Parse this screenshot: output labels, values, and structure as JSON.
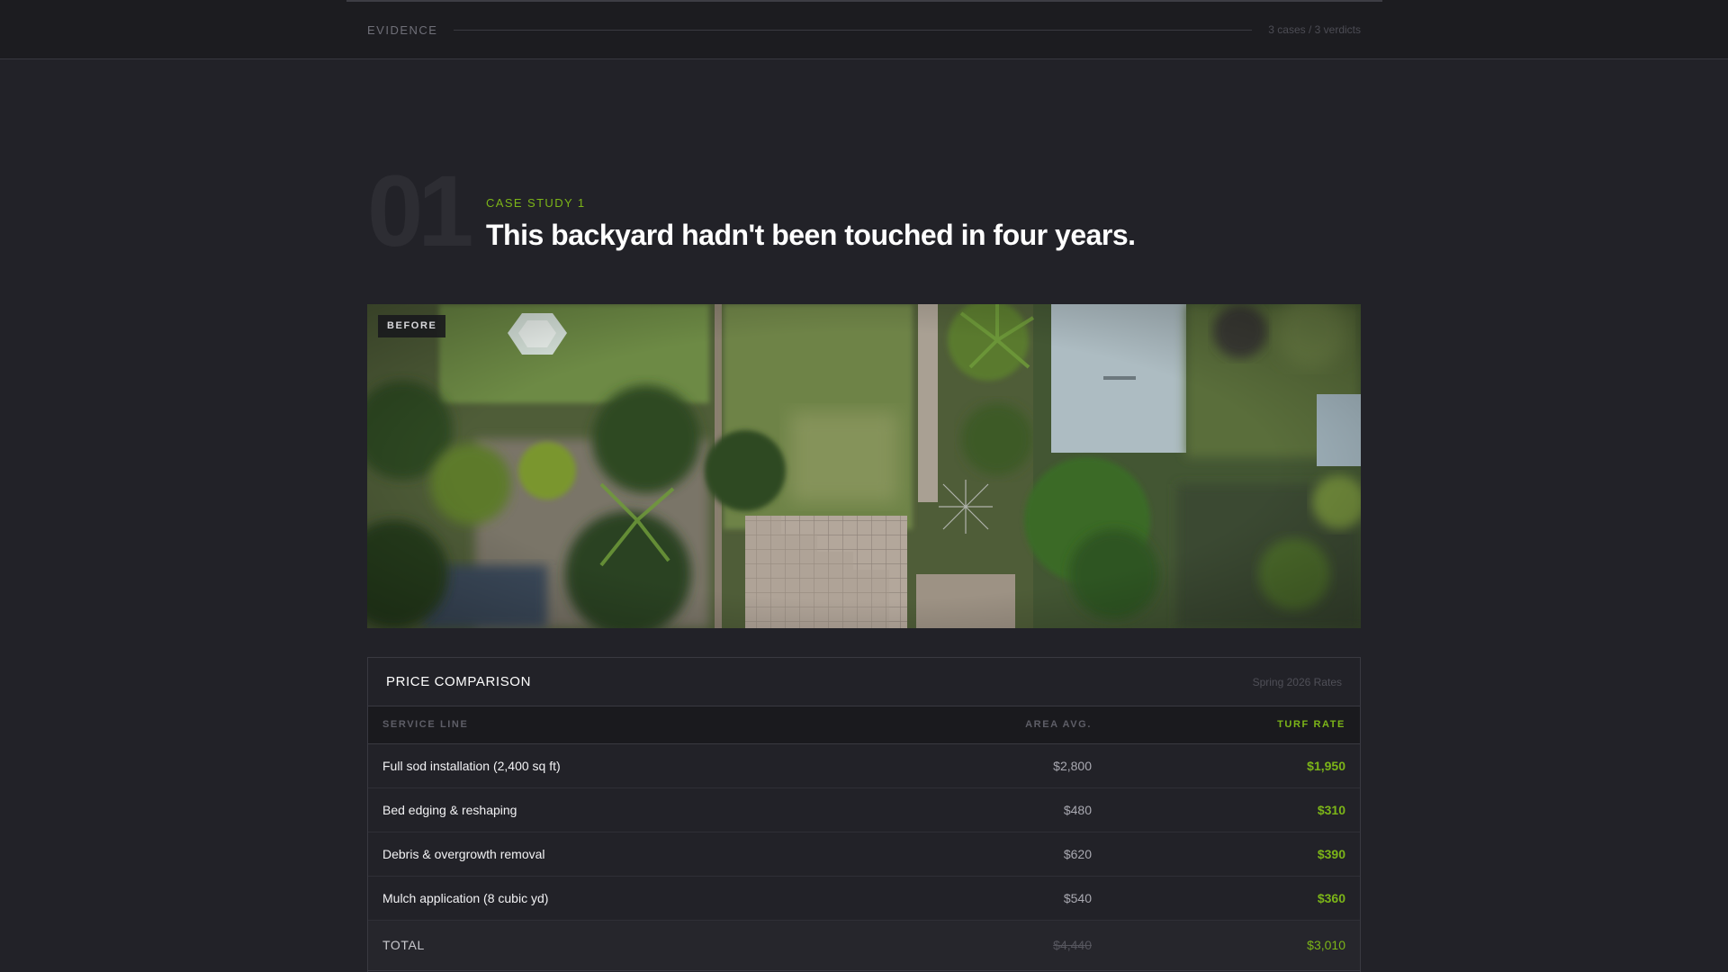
{
  "topbar": {
    "label": "EVIDENCE",
    "meta": "3 cases / 3 verdicts"
  },
  "case": {
    "number": "01",
    "kicker": "CASE STUDY 1",
    "title": "This backyard hadn't been touched in four years."
  },
  "photo": {
    "badge": "BEFORE"
  },
  "price": {
    "title": "PRICE COMPARISON",
    "subtitle": "Spring 2026 Rates",
    "headers": {
      "service": "SERVICE LINE",
      "area": "AREA AVG.",
      "turf": "TURF RATE"
    },
    "rows": [
      {
        "service": "Full sod installation (2,400 sq ft)",
        "area": "$2,800",
        "turf": "$1,950"
      },
      {
        "service": "Bed edging & reshaping",
        "area": "$480",
        "turf": "$310"
      },
      {
        "service": "Debris & overgrowth removal",
        "area": "$620",
        "turf": "$390"
      },
      {
        "service": "Mulch application (8 cubic yd)",
        "area": "$540",
        "turf": "$360"
      }
    ],
    "total": {
      "label": "TOTAL",
      "area": "$4,440",
      "turf": "$3,010"
    }
  },
  "colors": {
    "background": "#222228",
    "accent": "#7cb518",
    "text": "#ffffff",
    "muted": "#6f6f78"
  }
}
